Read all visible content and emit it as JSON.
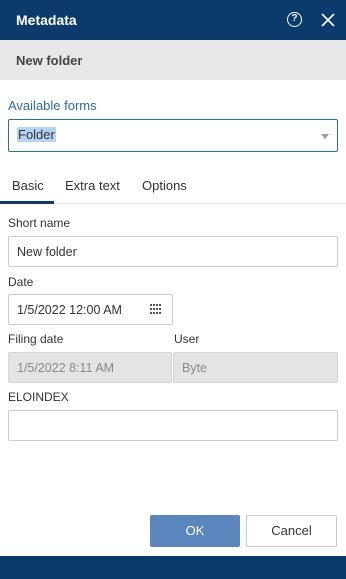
{
  "window": {
    "title": "Metadata",
    "help_icon_glyph": "?"
  },
  "subheader": {
    "name": "New folder"
  },
  "forms": {
    "label": "Available forms",
    "selected": "Folder"
  },
  "tabs": [
    {
      "label": "Basic",
      "active": true
    },
    {
      "label": "Extra text",
      "active": false
    },
    {
      "label": "Options",
      "active": false
    }
  ],
  "fields": {
    "short_name": {
      "label": "Short name",
      "value": "New folder"
    },
    "date": {
      "label": "Date",
      "value": "1/5/2022 12:00 AM"
    },
    "filing_date": {
      "label": "Filing date",
      "value": "1/5/2022 8:11 AM"
    },
    "user": {
      "label": "User",
      "value": "Byte"
    },
    "eloindex": {
      "label": "ELOINDEX",
      "value": ""
    }
  },
  "buttons": {
    "ok": "OK",
    "cancel": "Cancel"
  },
  "colors": {
    "titlebar": "#0b3b6d",
    "accent": "#2c6aa0",
    "ok_button": "#5a86bd"
  }
}
